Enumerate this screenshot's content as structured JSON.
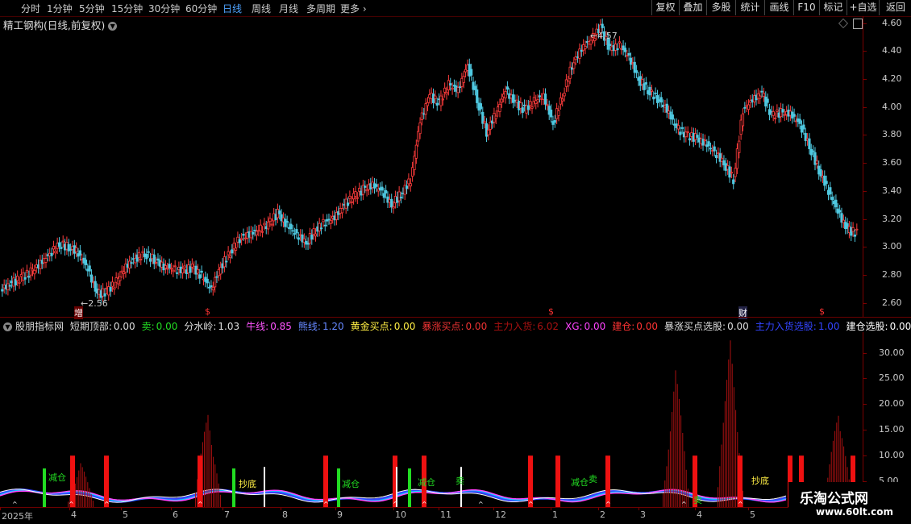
{
  "toolbar": {
    "periods": [
      "分时",
      "1分钟",
      "5分钟",
      "15分钟",
      "30分钟",
      "60分钟",
      "日线",
      "周线",
      "月线",
      "多周期"
    ],
    "active_period": "日线",
    "more": "更多",
    "right_buttons": [
      "复权",
      "叠加",
      "多股",
      "统计",
      "画线",
      "F10",
      "标记",
      "+自选",
      "返回"
    ]
  },
  "main_chart": {
    "title": "精工钢构(日线,前复权)",
    "y_ticks": [
      "4.60",
      "4.40",
      "4.20",
      "4.00",
      "3.80",
      "3.60",
      "3.40",
      "3.20",
      "3.00",
      "2.80",
      "2.60"
    ],
    "high_label": "4.57",
    "low_label": "2.56",
    "events": [
      "增",
      "$",
      "$",
      "财",
      "$"
    ]
  },
  "indicator": {
    "name": "股朋指标网",
    "fields": [
      {
        "label": "短期顶部:",
        "value": "0.00",
        "color": "#dddddd"
      },
      {
        "label": "卖:",
        "value": "0.00",
        "color": "#22dd22"
      },
      {
        "label": "分水岭:",
        "value": "1.03",
        "color": "#dddddd"
      },
      {
        "label": "牛线:",
        "value": "0.85",
        "color": "#ff55ff"
      },
      {
        "label": "熊线:",
        "value": "1.20",
        "color": "#6688ff"
      },
      {
        "label": "黄金买点:",
        "value": "0.00",
        "color": "#ffee44"
      },
      {
        "label": "暴涨买点:",
        "value": "0.00",
        "color": "#ee3333"
      },
      {
        "label": "主力入货:",
        "value": "6.02",
        "color": "#aa1111"
      },
      {
        "label": "XG:",
        "value": "0.00",
        "color": "#ff44ff"
      },
      {
        "label": "建仓:",
        "value": "0.00",
        "color": "#ff3333"
      },
      {
        "label": "暴涨买点选股:",
        "value": "0.00",
        "color": "#dddddd"
      },
      {
        "label": "主力入货选股:",
        "value": "1.00",
        "color": "#3344ff"
      },
      {
        "label": "建仓选股:",
        "value": "0.00",
        "color": "#ffffff"
      }
    ],
    "y_ticks": [
      "30.00",
      "25.00",
      "20.00",
      "15.00",
      "10.00",
      "5.00"
    ],
    "signals": [
      "减仓",
      "抄底",
      "减仓",
      "减仓",
      "卖",
      "减仓",
      "卖",
      "卖",
      "抄底"
    ]
  },
  "x_axis": [
    "2025年",
    "4",
    "5",
    "6",
    "7",
    "8",
    "9",
    "10",
    "11",
    "12",
    "1",
    "2",
    "3",
    "4",
    "5"
  ],
  "watermark": {
    "line1": "乐淘公式网",
    "line2": "www.60lt.com"
  },
  "colors": {
    "up": "#ff3c3c",
    "down": "#4fc8e0",
    "axis": "#7a0000",
    "spike": "#ee1111"
  },
  "chart_data": {
    "type": "candlestick",
    "title": "精工钢构(日线,前复权)",
    "ylim": [
      2.5,
      4.65
    ],
    "series": [
      {
        "values": [
          2.7,
          2.74,
          2.78,
          2.82,
          2.88,
          2.95,
          3.02,
          3.0,
          2.96,
          2.84,
          2.66,
          2.68,
          2.75,
          2.86,
          2.92,
          2.95,
          2.91,
          2.86,
          2.84,
          2.83,
          2.85,
          2.79,
          2.7,
          2.86,
          2.96,
          3.06,
          3.09,
          3.12,
          3.16,
          3.24,
          3.15,
          3.09,
          3.03,
          3.12,
          3.18,
          3.21,
          3.3,
          3.36,
          3.41,
          3.44,
          3.4,
          3.3,
          3.38,
          3.48,
          3.9,
          4.08,
          4.03,
          4.16,
          4.12,
          4.3,
          4.05,
          3.82,
          3.96,
          4.12,
          4.03,
          3.98,
          4.04,
          4.08,
          3.88,
          4.08,
          4.3,
          4.42,
          4.48,
          4.57,
          4.41,
          4.44,
          4.36,
          4.2,
          4.12,
          4.06,
          3.98,
          3.85,
          3.8,
          3.78,
          3.74,
          3.68,
          3.6,
          3.48,
          3.98,
          4.05,
          4.1,
          3.94,
          3.96,
          3.95,
          3.88,
          3.72,
          3.55,
          3.4,
          3.25,
          3.12,
          3.1
        ]
      }
    ]
  }
}
